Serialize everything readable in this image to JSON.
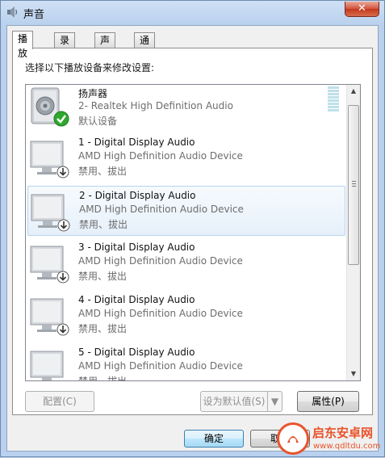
{
  "window": {
    "title": "声音",
    "close_label": "✕"
  },
  "tabs": [
    {
      "label": "播放",
      "active": true
    },
    {
      "label": "录制",
      "active": false
    },
    {
      "label": "声音",
      "active": false
    },
    {
      "label": "通信",
      "active": false
    }
  ],
  "instruction": "选择以下播放设备来修改设置:",
  "devices": [
    {
      "name": "扬声器",
      "description": "2- Realtek High Definition Audio",
      "status": "默认设备",
      "icon": "speaker-icon",
      "badge": "check-badge-icon"
    },
    {
      "name": "1 - Digital Display Audio",
      "description": "AMD High Definition Audio Device",
      "status": "禁用、拔出",
      "icon": "monitor-icon",
      "badge": "unplugged-badge-icon"
    },
    {
      "name": "2 - Digital Display Audio",
      "description": "AMD High Definition Audio Device",
      "status": "禁用、拔出",
      "icon": "monitor-icon",
      "badge": "unplugged-badge-icon",
      "selected": true
    },
    {
      "name": "3 - Digital Display Audio",
      "description": "AMD High Definition Audio Device",
      "status": "禁用、拔出",
      "icon": "monitor-icon",
      "badge": "unplugged-badge-icon"
    },
    {
      "name": "4 - Digital Display Audio",
      "description": "AMD High Definition Audio Device",
      "status": "禁用、拔出",
      "icon": "monitor-icon",
      "badge": "unplugged-badge-icon"
    },
    {
      "name": "5 - Digital Display Audio",
      "description": "AMD High Definition Audio Device",
      "status": "禁用、拔出",
      "icon": "monitor-icon",
      "badge": "unplugged-badge-icon"
    }
  ],
  "buttons": {
    "configure": "配置(C)",
    "set_default": "设为默认值(S)",
    "properties": "属性(P)",
    "ok": "确定",
    "cancel": "取消"
  },
  "watermark": {
    "line1": "启东安卓网",
    "line2": "www.qdltdu.com"
  },
  "colors": {
    "accent": "#3c7fb1",
    "watermark": "#e9542b",
    "check": "#2fa82f"
  }
}
